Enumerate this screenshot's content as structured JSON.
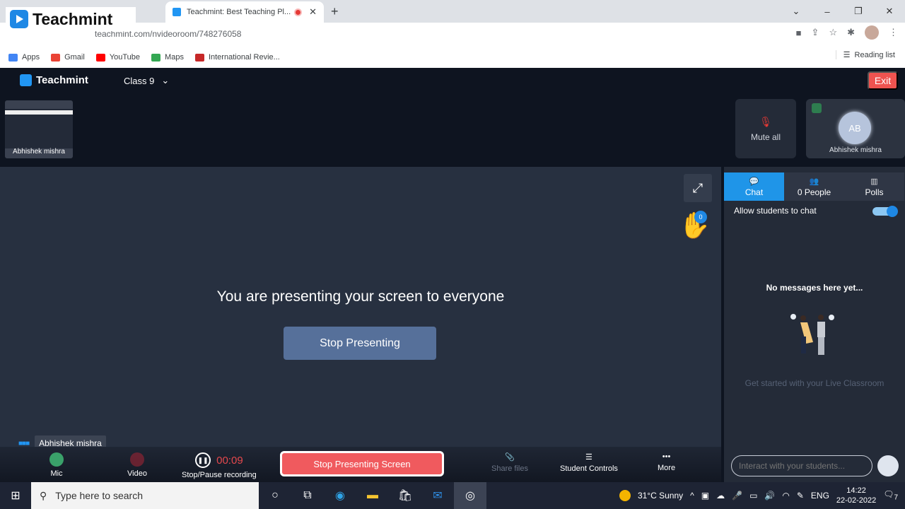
{
  "browser": {
    "active_tab_title": "Teachmint: Best Teaching Pl...",
    "new_tab": "+",
    "url": "teachmint.com/nvideoroom/748276058",
    "bookmarks": [
      {
        "label": "Apps",
        "color": "#4285f4"
      },
      {
        "label": "Gmail",
        "color": "#ea4335"
      },
      {
        "label": "YouTube",
        "color": "#ff0000"
      },
      {
        "label": "Maps",
        "color": "#34a853"
      },
      {
        "label": "International Revie...",
        "color": "#c62828"
      }
    ],
    "reading_list": "Reading list",
    "overlay_logo": "Teachmint"
  },
  "app": {
    "logo": "Teachmint",
    "class_selector": "Class 9",
    "exit_label": "Exit",
    "self_tile_name": "Abhishek mishra",
    "mute_all_label": "Mute all",
    "participant": {
      "initials": "AB",
      "name": "Abhishek mishra"
    },
    "stage": {
      "message": "You are presenting your screen to everyone",
      "stop_presenting": "Stop Presenting",
      "raised_hands": "0",
      "active_speaker": "Abhishek mishra"
    },
    "controls": {
      "mic": "Mic",
      "video": "Video",
      "recording": "Stop/Pause recording",
      "timer": "00:09",
      "stop_screen": "Stop Presenting Screen",
      "share_files": "Share files",
      "student_controls": "Student Controls",
      "more": "More"
    },
    "panel": {
      "tabs": [
        {
          "label": "Chat",
          "active": true
        },
        {
          "label": "0 People",
          "active": false
        },
        {
          "label": "Polls",
          "active": false
        }
      ],
      "allow_chat_label": "Allow students to chat",
      "allow_chat_enabled": true,
      "empty_title": "No messages here yet...",
      "empty_subtitle": "Get started with your Live Classroom",
      "input_placeholder": "Interact with your students..."
    },
    "accent_color": "#1f95e8",
    "danger_color": "#f05a5e"
  },
  "taskbar": {
    "search_placeholder": "Type here to search",
    "weather": "31°C  Sunny",
    "language": "ENG",
    "time": "14:22",
    "date": "22-02-2022",
    "notifications": "7"
  }
}
